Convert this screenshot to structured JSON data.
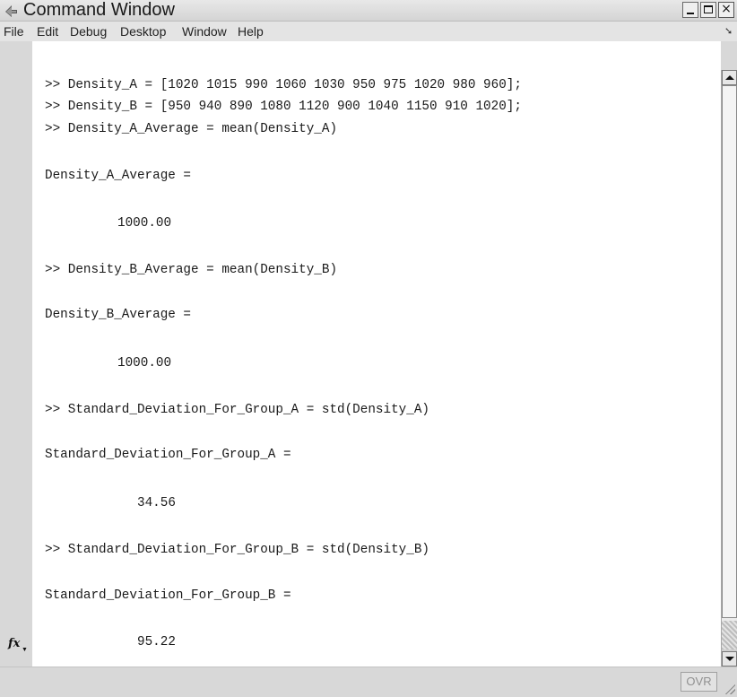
{
  "window": {
    "title": "Command Window"
  },
  "menu": {
    "items": [
      "File",
      "Edit",
      "Debug",
      "Desktop",
      "Window",
      "Help"
    ]
  },
  "console": {
    "lines": [
      ">> Density_A = [1020 1015 990 1060 1030 950 975 1020 980 960];",
      ">> Density_B = [950 940 890 1080 1120 900 1040 1150 910 1020];",
      ">> Density_A_Average = mean(Density_A)",
      "Density_A_Average =",
      "1000.00",
      ">> Density_B_Average = mean(Density_B)",
      "Density_B_Average =",
      "1000.00",
      ">> Standard_Deviation_For_Group_A = std(Density_A)",
      "Standard_Deviation_For_Group_A =",
      "34.56",
      ">> Standard_Deviation_For_Group_B = std(Density_B)",
      "Standard_Deviation_For_Group_B =",
      "95.22"
    ]
  },
  "prompt": {
    "fx_label": "fx"
  },
  "status": {
    "ovr": "OVR"
  },
  "icons": {
    "title_icon": "matlab-command-icon",
    "fx_icon": "function-browser-icon"
  }
}
